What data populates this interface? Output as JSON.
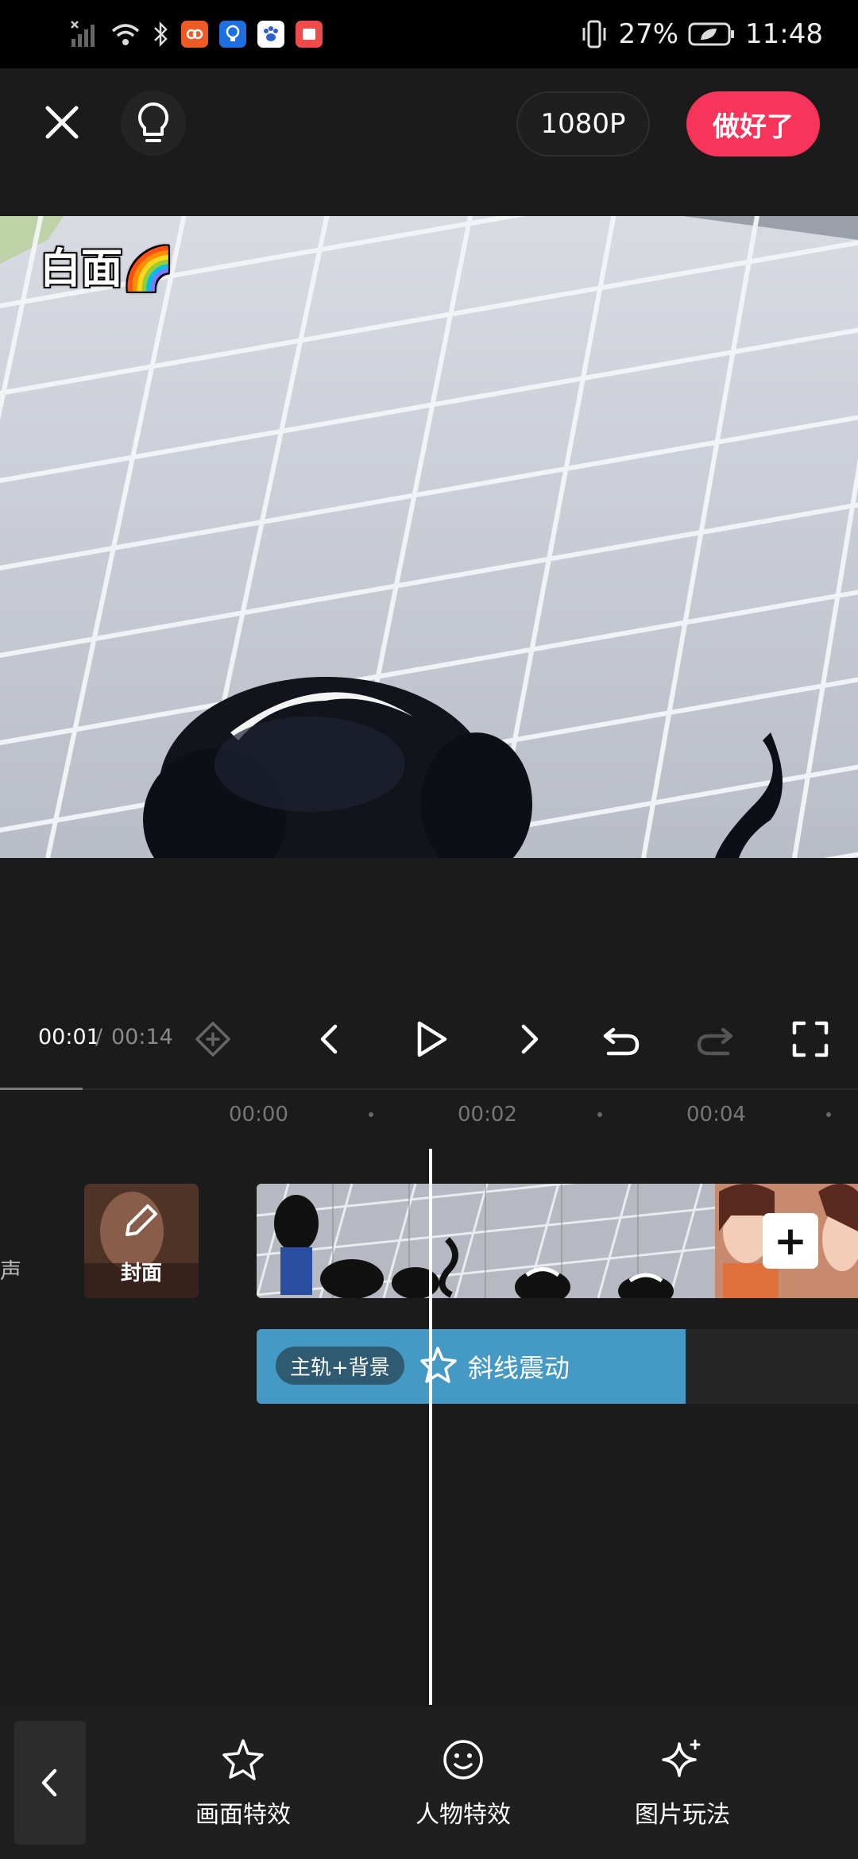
{
  "status_bar": {
    "battery": "27%",
    "time": "11:48"
  },
  "toolbar": {
    "resolution": "1080P",
    "done_label": "做好了"
  },
  "preview": {
    "watermark": "白面🌈"
  },
  "playback": {
    "current_time": "00:01",
    "separator": "/",
    "total_time": "00:14"
  },
  "timeline": {
    "ruler": [
      "00:00",
      "00:02",
      "00:04"
    ],
    "track_label": "声",
    "cover_label": "封面",
    "add_symbol": "+",
    "effect": {
      "tag": "主轨+背景",
      "name": "斜线震动",
      "color": "#4599c5"
    }
  },
  "bottom_tabs": [
    {
      "label": "画面特效",
      "icon": "sparkle-star-icon"
    },
    {
      "label": "人物特效",
      "icon": "smiley-face-icon"
    },
    {
      "label": "图片玩法",
      "icon": "magic-sparkles-icon"
    }
  ],
  "colors": {
    "accent": "#f7355a",
    "background": "#1b1b1b"
  }
}
